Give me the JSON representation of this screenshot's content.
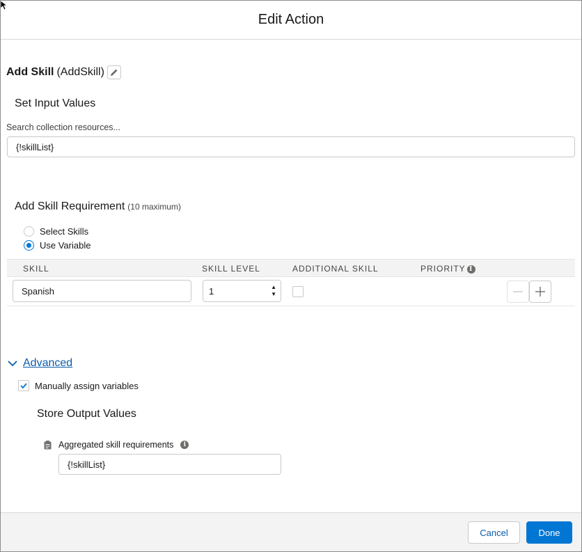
{
  "modal": {
    "title": "Edit Action"
  },
  "action": {
    "name": "Add Skill",
    "api_name": "(AddSkill)"
  },
  "input_values": {
    "heading": "Set Input Values",
    "search_label": "Search collection resources...",
    "search_value": "{!skillList}"
  },
  "skill_requirement": {
    "heading": "Add Skill Requirement",
    "note": "(10 maximum)",
    "options": [
      {
        "label": "Select Skills",
        "selected": false
      },
      {
        "label": "Use Variable",
        "selected": true
      }
    ],
    "columns": [
      "SKILL",
      "SKILL LEVEL",
      "ADDITIONAL SKILL",
      "PRIORITY"
    ],
    "row": {
      "skill": "Spanish",
      "level": "1",
      "additional": false
    }
  },
  "advanced": {
    "label": "Advanced",
    "manual_label": "Manually assign variables",
    "manual_checked": true
  },
  "output": {
    "heading": "Store Output Values",
    "field_label": "Aggregated skill requirements",
    "field_value": "{!skillList}"
  },
  "footer": {
    "cancel": "Cancel",
    "done": "Done"
  },
  "colors": {
    "brand": "#0176d3",
    "link": "#0b5cab",
    "border": "#c9c9c9",
    "footer_bg": "#f3f3f3"
  },
  "icons": [
    "pencil-icon",
    "info-icon",
    "chevron-down-icon",
    "check-icon",
    "clipboard-icon",
    "minus-icon",
    "plus-icon"
  ]
}
